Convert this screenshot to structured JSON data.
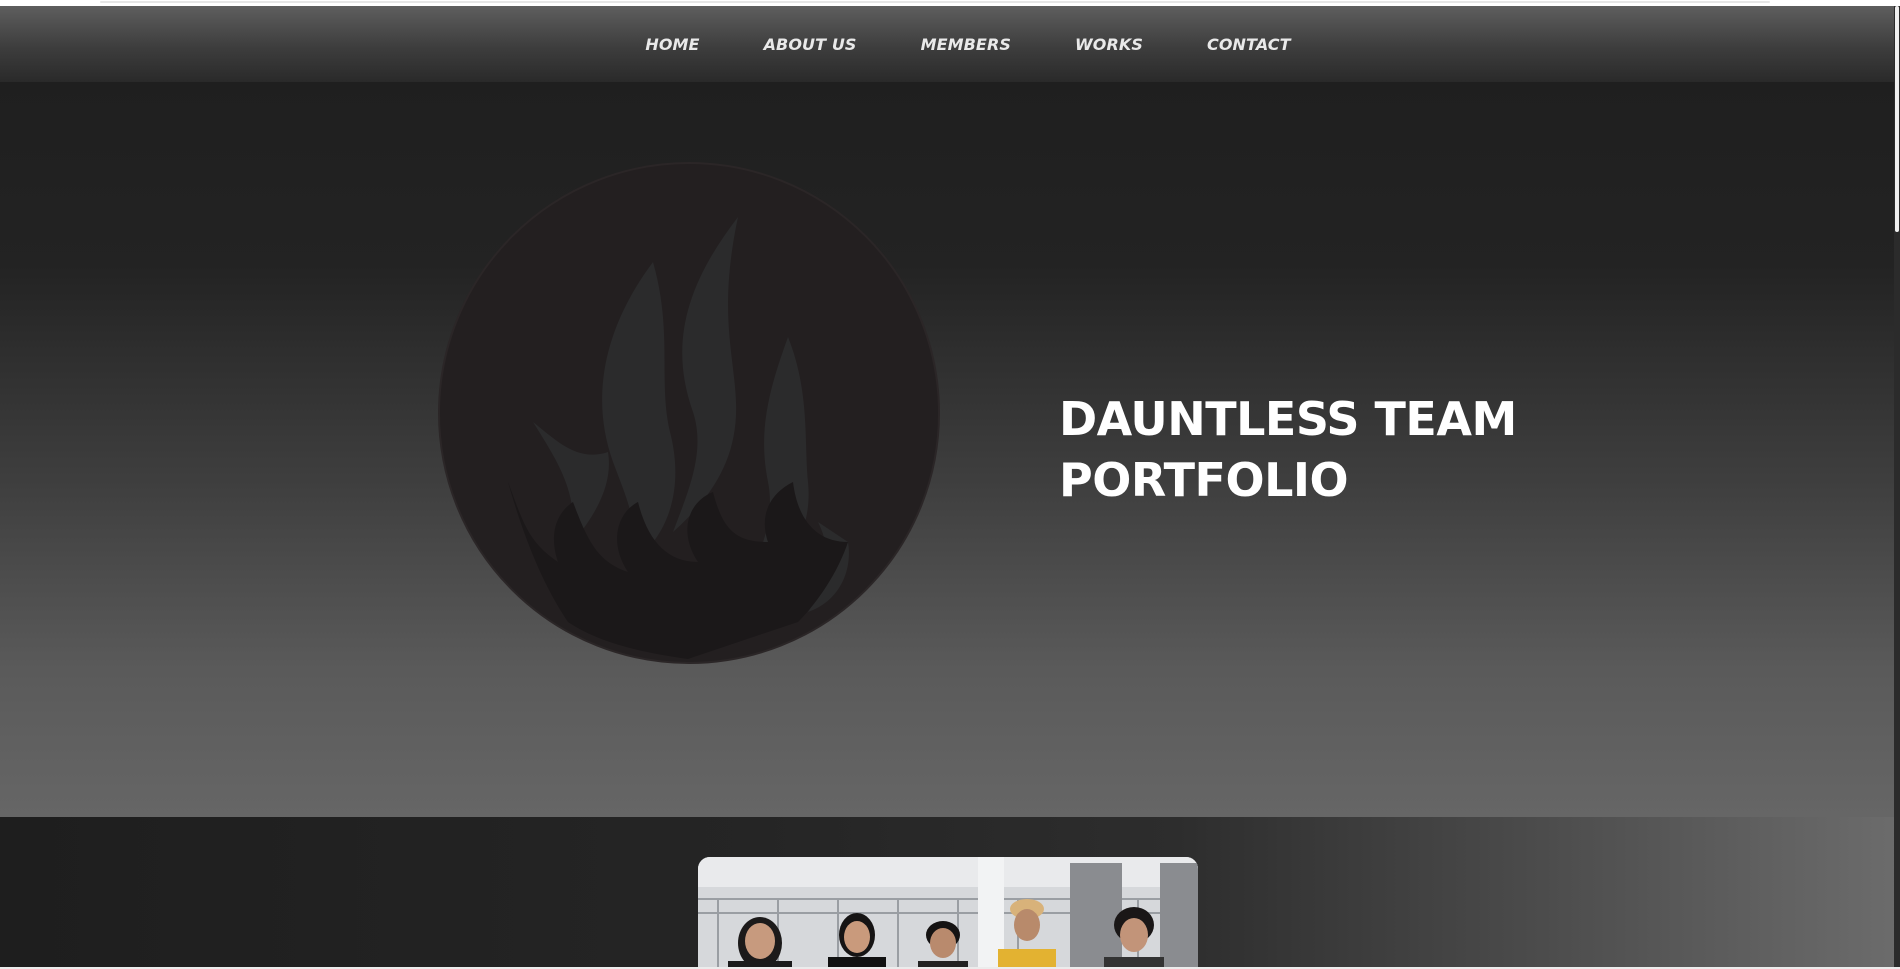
{
  "nav": {
    "items": [
      {
        "label": "HOME"
      },
      {
        "label": "ABOUT US"
      },
      {
        "label": "MEMBERS"
      },
      {
        "label": "WORKS"
      },
      {
        "label": "CONTACT"
      }
    ]
  },
  "hero": {
    "title_line1": "DAUNTLESS TEAM",
    "title_line2": "PORTFOLIO",
    "logo_icon": "flame-circle-icon"
  },
  "team": {
    "photo_icon": "team-photo"
  },
  "colors": {
    "nav_text": "#e9e9e9",
    "hero_title": "#ffffff",
    "logo_fill": "#231f20",
    "flame_fill": "#2a2a2a"
  }
}
